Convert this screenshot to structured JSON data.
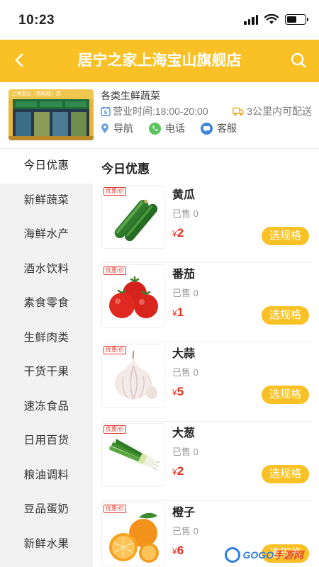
{
  "status_bar": {
    "time": "10:23"
  },
  "header": {
    "title": "居宁之家上海宝山旗舰店"
  },
  "store": {
    "photo_sign": "上海宝山（俏和路）店",
    "category": "各类生鲜蔬菜",
    "hours_label": "营业时间:18:00-20:00",
    "delivery": "3公里内可配送",
    "actions": [
      {
        "label": "导航",
        "icon": "location-icon"
      },
      {
        "label": "电话",
        "icon": "phone-icon"
      },
      {
        "label": "客服",
        "icon": "chat-icon"
      }
    ]
  },
  "sidebar": {
    "items": [
      {
        "label": "今日优惠",
        "active": true
      },
      {
        "label": "新鲜蔬菜"
      },
      {
        "label": "海鲜水产"
      },
      {
        "label": "酒水饮料"
      },
      {
        "label": "素食零食"
      },
      {
        "label": "生鲜肉类"
      },
      {
        "label": "干货干果"
      },
      {
        "label": "速冻食品"
      },
      {
        "label": "日用百货"
      },
      {
        "label": "粮油调料"
      },
      {
        "label": "豆品蛋奶"
      },
      {
        "label": "新鲜水果"
      }
    ]
  },
  "main": {
    "section_title": "今日优惠",
    "promo_tag": "优惠/价",
    "currency": "¥",
    "spec_button": "选规格",
    "products": [
      {
        "name": "黄瓜",
        "sold": "已售 0",
        "price": "2",
        "image": "cucumber"
      },
      {
        "name": "番茄",
        "sold": "已售 0",
        "price": "1",
        "image": "tomato"
      },
      {
        "name": "大蒜",
        "sold": "已售 0",
        "price": "5",
        "image": "garlic"
      },
      {
        "name": "大葱",
        "sold": "已售 0",
        "price": "2",
        "image": "scallion"
      },
      {
        "name": "橙子",
        "sold": "已售 0",
        "price": "6",
        "image": "orange"
      }
    ]
  },
  "watermark": {
    "text_a": "GOGO",
    "text_b": "手游网"
  },
  "colors": {
    "accent": "#f9c126",
    "price": "#e0301e",
    "sidebar_bg": "#f2f2f2"
  }
}
